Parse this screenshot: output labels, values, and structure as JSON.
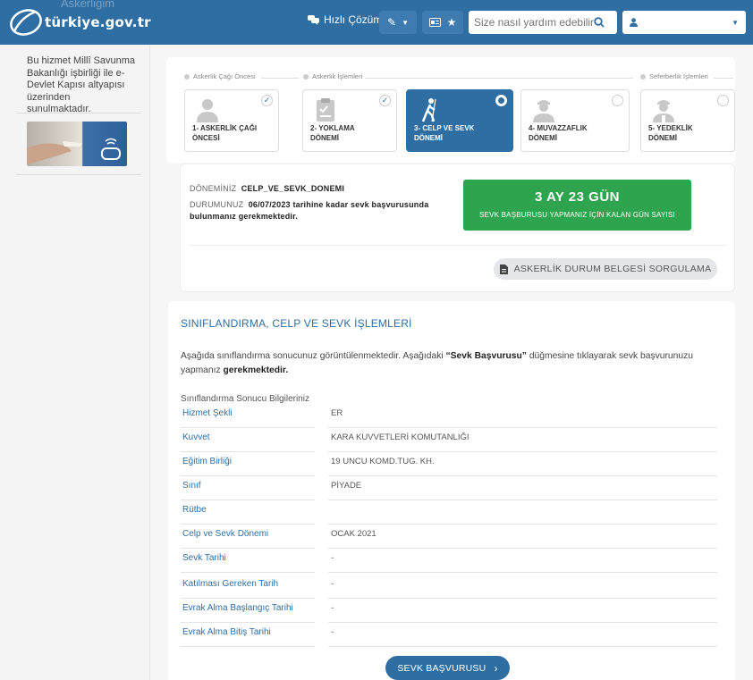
{
  "header": {
    "logo_text": "türkiye.gov.tr",
    "ghost_title": "Askerliğim",
    "quick_solution": "Hızlı Çözüm",
    "search_placeholder": "Size nasıl yardım edebilirim?",
    "colors": {
      "bar": "#2f6ea3",
      "button": "#3d7bb0"
    }
  },
  "sidebar": {
    "text": "Bu hizmet Millî Savunma Bakanlığı işbirliği ile e-Devlet Kapısı altyapısı üzerinden sunulmaktadır."
  },
  "phases": {
    "before": "Askerlik Çağı Öncesi",
    "process": "Askerlik İşlemleri",
    "mobilization": "Seferberlik İşlemleri"
  },
  "steps": [
    {
      "label": "1- ASKERLİK ÇAĞI ÖNCESİ",
      "icon": "person-icon",
      "state": "done",
      "check": "✓"
    },
    {
      "label": "2- YOKLAMA DÖNEMİ",
      "icon": "clipboard-icon",
      "state": "done",
      "check": "✓"
    },
    {
      "label": "3- CELP VE SEVK DÖNEMİ",
      "icon": "walking-soldier-icon",
      "state": "active",
      "check": ""
    },
    {
      "label": "4- MUVAZZAFLIK DÖNEMİ",
      "icon": "soldier-icon",
      "state": "pending",
      "check": ""
    },
    {
      "label": "5- YEDEKLİK DÖNEMİ",
      "icon": "reserve-soldier-icon",
      "state": "pending",
      "check": ""
    }
  ],
  "donem": {
    "period_label": "DÖNEMİNİZ",
    "period_value": "CELP_VE_SEVK_DONEMI",
    "status_label": "DURUMUNUZ",
    "status_value_1": "06/07/2023 tarihine kadar sevk başvurusunda",
    "status_value_2": "bulunmanız gerekmektedir.",
    "countdown": "3 AY 23 GÜN",
    "countdown_caption": "SEVK BAŞBURUSU YAPMANIZ İÇİN KALAN GÜN SAYISI",
    "certificate_button": "ASKERLİK DURUM BELGESİ SORGULAMA",
    "accent_green": "#2ea44f"
  },
  "info": {
    "title": "SINIFLANDIRMA, CELP VE SEVK İŞLEMLERİ",
    "desc_1": "Aşağıda sınıflandırma sonucunuz görüntülenmektedir. Aşağıdaki ",
    "desc_bold": "“Sevk Başvurusu”",
    "desc_2": " düğmesine tıklayarak sevk başvurunuzu",
    "desc_3": "yapmanız ",
    "desc_bold2": "gerekmektedir.",
    "subtitle": "Sınıflandırma Sonucu Bilgileriniz",
    "rows": [
      {
        "key": "Hizmet Şekli",
        "value": "ER"
      },
      {
        "key": "Kuvvet",
        "value": "KARA KUVVETLERİ KOMUTANLIĞI"
      },
      {
        "key": "Eğitim Birliği",
        "value": "19 UNCU KOMD.TUG. KH."
      },
      {
        "key": "Sınıf",
        "value": "PİYADE"
      },
      {
        "key": "Rütbe",
        "value": ""
      },
      {
        "key": "Celp ve Sevk Dönemi",
        "value": "OCAK 2021"
      },
      {
        "key": "Sevk Tarihi",
        "value": "-"
      },
      {
        "key": "Katılması Gereken Tarih",
        "value": "-"
      },
      {
        "key": "Evrak Alma Başlangıç Tarihi",
        "value": "-"
      },
      {
        "key": "Evrak Alma Bitiş Tarihi",
        "value": "-"
      }
    ],
    "submit_button": "SEVK BAŞVURUSU"
  }
}
